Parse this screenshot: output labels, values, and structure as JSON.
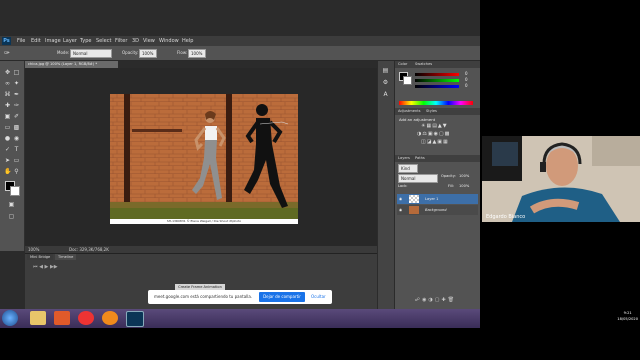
{
  "photoshop": {
    "logo": "Ps",
    "menu": [
      "File",
      "Edit",
      "Image",
      "Layer",
      "Type",
      "Select",
      "Filter",
      "3D",
      "View",
      "Window",
      "Help"
    ],
    "options": {
      "mode_label": "Mode:",
      "mode_value": "Normal",
      "opacity_label": "Opacity:",
      "opacity_value": "100%",
      "flow_label": "Flow:",
      "flow_value": "100%"
    },
    "workspace": "Essentials",
    "document_tab": "chica.jpg @ 100% (Layer 1, RGB/8#) *",
    "status_zoom": "100%",
    "status_doc": "Doc: 329,3K/768,2K",
    "caption": "SH-13R0831 © Elena Weigell / Die Shout Xtphoto",
    "timeline_tabs": [
      "Mini Bridge",
      "Timeline"
    ],
    "create_animation_button": "Create Frame Animation",
    "color_panel_tabs": [
      "Color",
      "Swatches"
    ],
    "color_values": {
      "r": "0",
      "g": "0",
      "b": "0"
    },
    "adjustments_tabs": [
      "Adjustments",
      "Styles"
    ],
    "adjustments_hint": "Add an adjustment",
    "layers_tabs": [
      "Layers",
      "Paths"
    ],
    "layers_kind": "Kind",
    "layers_blend": "Normal",
    "layers_opacity_label": "Opacity:",
    "layers_opacity_value": "100%",
    "layers_lock_label": "Lock:",
    "layers_fill_label": "Fill:",
    "layers_fill_value": "100%",
    "layers": [
      {
        "name": "Layer 1"
      },
      {
        "name": "Background"
      }
    ]
  },
  "meet": {
    "share_text": "meet.google.com está compartiendo tu pantalla.",
    "stop_button": "Dejar de compartir",
    "hide_button": "Ocultar"
  },
  "taskbar": {
    "time": "9:21",
    "date": "18/05/2020"
  },
  "participant": {
    "name": "Edgardo Bianco"
  },
  "colors": {
    "ps_bg": "#2b2b2b",
    "panel": "#535353",
    "accent": "#1a73e8",
    "wall": "#b56a3a"
  }
}
